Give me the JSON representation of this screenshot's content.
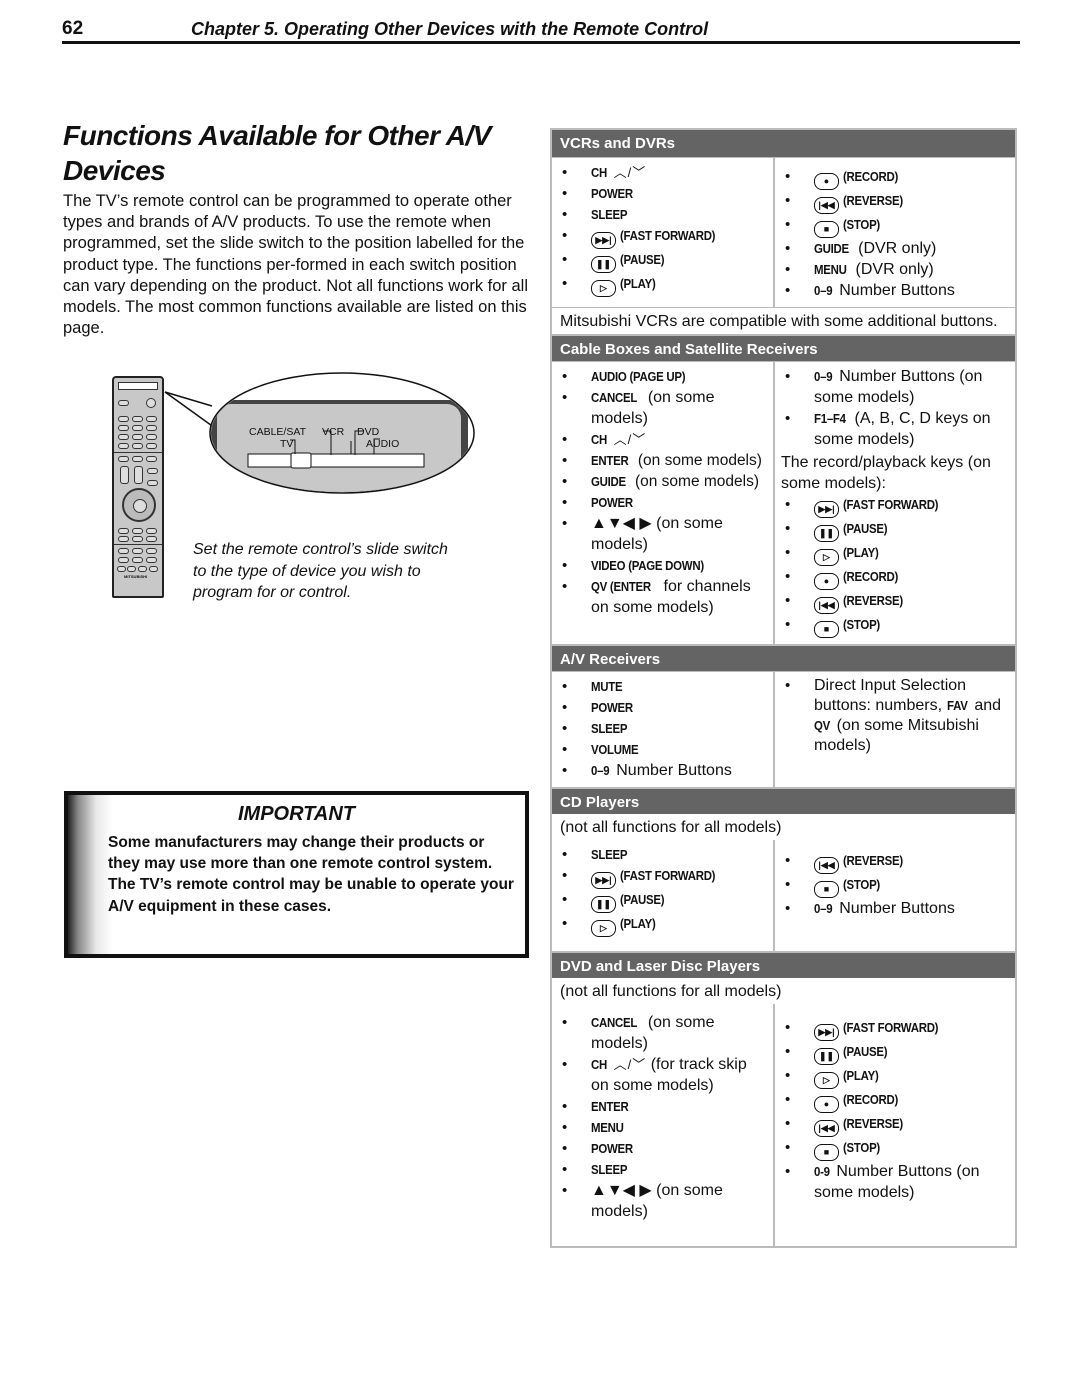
{
  "header": {
    "page_number": "62",
    "chapter": "Chapter 5.  Operating Other Devices with the Remote Control"
  },
  "title": "Functions Available for Other A/V Devices",
  "intro": "The TV’s remote control can be programmed to operate other types and brands of A/V products.  To use the remote when programmed, set the slide switch to the position labelled for the product type.  The functions per-formed in each switch position can vary depending on the product.  Not all functions work for all models.  The most common functions available are listed on this page.",
  "figure": {
    "switch_labels": {
      "cable_sat": "CABLE/SAT",
      "vcr": "VCR",
      "dvd": "DVD",
      "tv": "TV",
      "audio": "AUDIO"
    },
    "remote_brand": "MITSUBISHI",
    "caption": "Set the remote control’s slide switch to the type of device you wish to program for or control."
  },
  "important": {
    "title": "IMPORTANT",
    "text": "Some manufacturers may change their products or they may use more than one remote control system.  The TV’s remote control may be unable to operate your A/V equipment in these cases."
  },
  "sections": {
    "vcr": {
      "title": "VCRs and DVRs",
      "left": {
        "ch": "CH",
        "power": "POWER",
        "sleep": "SLEEP",
        "ff": "(FAST FORWARD)",
        "pause": "(PAUSE)",
        "play": "(PLAY)"
      },
      "right": {
        "record": "(RECORD)",
        "reverse": "(REVERSE)",
        "stop": "(STOP)",
        "guide_key": "GUIDE",
        "guide_note": " (DVR only)",
        "menu_key": "MENU",
        "menu_note": " (DVR only)",
        "num_key": "0–9",
        "num_note": " Number Buttons"
      },
      "note": "Mitsubishi VCRs are compatible with some additional buttons."
    },
    "cable": {
      "title": "Cable Boxes and Satellite Receivers",
      "left": {
        "audio": "AUDIO (PAGE UP)",
        "cancel_key": "CANCEL",
        "cancel_note": " (on some models)",
        "ch": "CH",
        "enter_key": "ENTER",
        "enter_note": " (on some models)",
        "guide_key": "GUIDE",
        "guide_note": " (on some models)",
        "power": "POWER",
        "arrows": "▲▼◀ ▶",
        "arrows_note": " (on some models)",
        "video": "VIDEO (PAGE DOWN)",
        "qv_key": "QV (ENTER",
        "qv_note": " for channels on some models)"
      },
      "right": {
        "num_key": "0–9",
        "num_note": " Number Buttons (on some models)",
        "f_key": "F1–F4",
        "f_note": " (A, B, C, D keys on some models)",
        "record_playback_note": "The record/playback keys (on some models):",
        "ff": "(FAST FORWARD)",
        "pause": "(PAUSE)",
        "play": "(PLAY)",
        "record": "(RECORD)",
        "reverse": "(REVERSE)",
        "stop": "(STOP)"
      }
    },
    "av": {
      "title": "A/V Receivers",
      "left": {
        "mute": "MUTE",
        "power": "POWER",
        "sleep": "SLEEP",
        "volume": "VOLUME",
        "num_key": "0–9",
        "num_note": " Number Buttons"
      },
      "right": {
        "direct_1": "Direct Input Selection buttons:  numbers, ",
        "fav_key": "FAV",
        "and": " and ",
        "qv_key": "QV",
        "direct_2": " (on some Mitsubishi models)"
      }
    },
    "cd": {
      "title": "CD Players",
      "note": "(not all functions for all models)",
      "left": {
        "sleep": "SLEEP",
        "ff": "(FAST FORWARD)",
        "pause": "(PAUSE)",
        "play": "(PLAY)"
      },
      "right": {
        "reverse": "(REVERSE)",
        "stop": "(STOP)",
        "num_key": "0–9",
        "num_note": " Number Buttons"
      }
    },
    "dvd": {
      "title": "DVD and Laser Disc Players",
      "note": "(not all functions for all models)",
      "left": {
        "cancel_key": "CANCEL",
        "cancel_note": " (on some models)",
        "ch": "CH",
        "ch_note": " (for track skip on some models)",
        "enter": "ENTER",
        "menu": "MENU",
        "power": "POWER",
        "sleep": "SLEEP",
        "arrows": "▲▼◀ ▶",
        "arrows_note": " (on some models)"
      },
      "right": {
        "ff": "(FAST FORWARD)",
        "pause": "(PAUSE)",
        "play": "(PLAY)",
        "record": "(RECORD)",
        "reverse": "(REVERSE)",
        "stop": "(STOP)",
        "num_key": "0-9",
        "num_note": " Number Buttons (on some models)"
      }
    }
  },
  "icons": {
    "ff": "▶▶|",
    "pause": "❚❚",
    "play": "▷",
    "record": "●",
    "reverse": "|◀◀",
    "stop": "■",
    "ch_updown": "︿/﹀"
  }
}
